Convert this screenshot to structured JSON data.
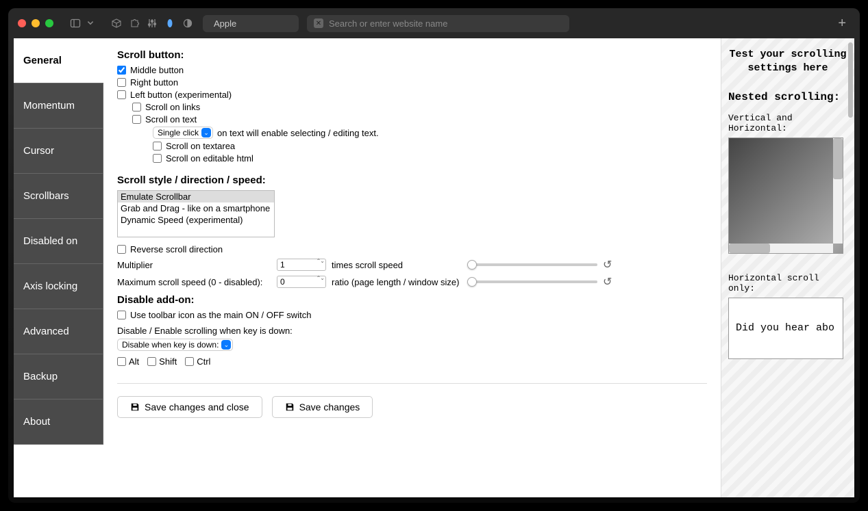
{
  "titlebar": {
    "url_label": "Apple",
    "search_placeholder": "Search or enter website name"
  },
  "sidebar": {
    "items": [
      {
        "label": "General"
      },
      {
        "label": "Momentum"
      },
      {
        "label": "Cursor"
      },
      {
        "label": "Scrollbars"
      },
      {
        "label": "Disabled on"
      },
      {
        "label": "Axis locking"
      },
      {
        "label": "Advanced"
      },
      {
        "label": "Backup"
      },
      {
        "label": "About"
      }
    ]
  },
  "scroll_button": {
    "heading": "Scroll button:",
    "middle": "Middle button",
    "right": "Right button",
    "left": "Left button (experimental)",
    "scroll_links": "Scroll on links",
    "scroll_text": "Scroll on text",
    "click_mode": "Single click",
    "click_suffix": "on text will enable selecting / editing text.",
    "scroll_textarea": "Scroll on textarea",
    "scroll_editable": "Scroll on editable html"
  },
  "scroll_style": {
    "heading": "Scroll style / direction / speed:",
    "options": [
      "Emulate Scrollbar",
      "Grab and Drag - like on a smartphone",
      "Dynamic Speed (experimental)"
    ],
    "reverse": "Reverse scroll direction",
    "multiplier_label": "Multiplier",
    "multiplier_value": "1",
    "multiplier_suffix": "times scroll speed",
    "max_label": "Maximum scroll speed (0 - disabled):",
    "max_value": "0",
    "max_suffix": "ratio (page length / window size)"
  },
  "disable_addon": {
    "heading": "Disable add-on:",
    "toolbar_switch": "Use toolbar icon as the main ON / OFF switch",
    "key_label": "Disable / Enable scrolling when key is down:",
    "key_mode": "Disable when key is down:",
    "alt": "Alt",
    "shift": "Shift",
    "ctrl": "Ctrl"
  },
  "footer": {
    "save_close": "Save changes and close",
    "save": "Save changes"
  },
  "test": {
    "heading": "Test your scrolling settings here",
    "nested": "Nested scrolling:",
    "vh": "Vertical and Horizontal:",
    "horiz": "Horizontal scroll only:",
    "horiz_text": "Did you hear abo"
  }
}
